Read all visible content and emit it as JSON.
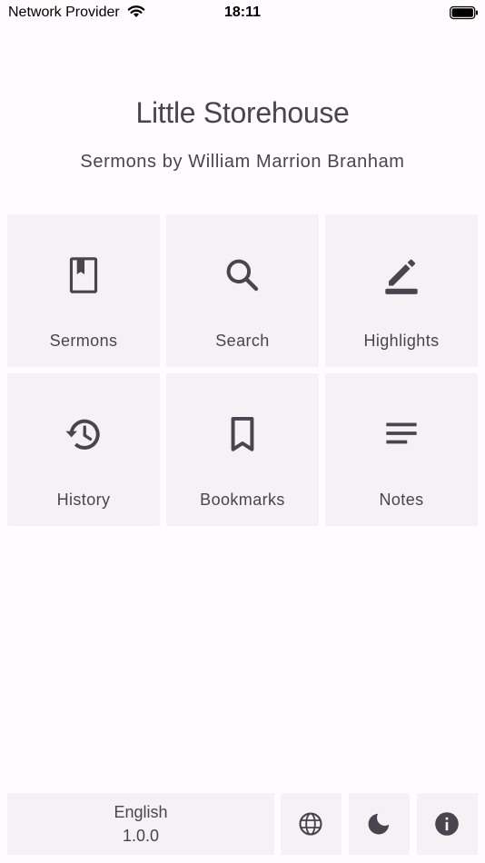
{
  "status_bar": {
    "carrier": "Network Provider",
    "time": "18:11",
    "wifi_icon": "wifi-icon",
    "battery_icon": "battery-icon"
  },
  "header": {
    "title": "Little Storehouse",
    "subtitle": "Sermons by William Marrion Branham"
  },
  "colors": {
    "background": "#fffbfe",
    "tile": "#f6f1f5",
    "icon": "#49454f",
    "text": "#49454f"
  },
  "grid": {
    "items": [
      {
        "label": "Sermons",
        "icon": "book-icon"
      },
      {
        "label": "Search",
        "icon": "search-icon"
      },
      {
        "label": "Highlights",
        "icon": "highlight-pen-icon"
      },
      {
        "label": "History",
        "icon": "history-icon"
      },
      {
        "label": "Bookmarks",
        "icon": "bookmark-icon"
      },
      {
        "label": "Notes",
        "icon": "notes-icon"
      }
    ]
  },
  "footer": {
    "language": "English",
    "version": "1.0.0",
    "buttons": [
      {
        "icon": "globe-icon"
      },
      {
        "icon": "dark-mode-icon"
      },
      {
        "icon": "info-icon"
      }
    ]
  }
}
